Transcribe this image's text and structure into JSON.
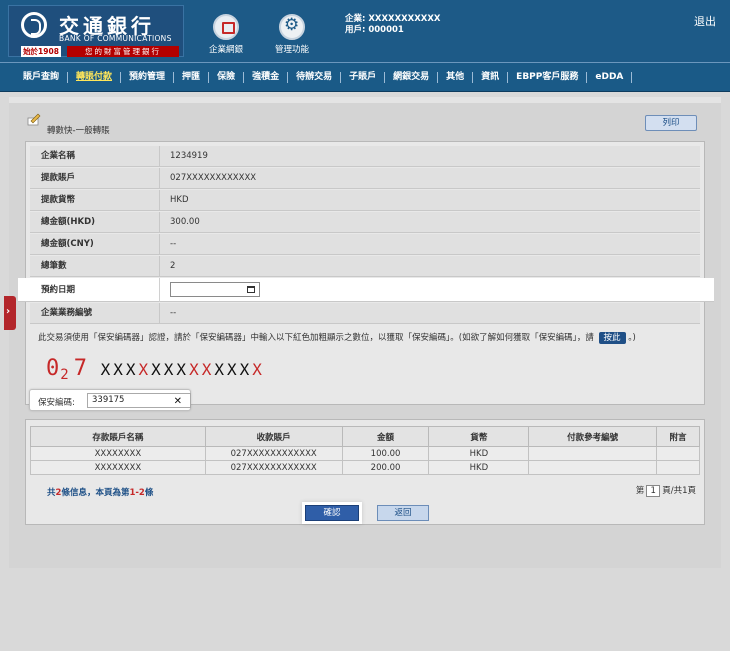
{
  "header": {
    "logo": {
      "cn": "交通銀行",
      "en": "BANK OF COMMUNICATIONS",
      "since": "始於1908",
      "slogan": "您的財富管理銀行"
    },
    "buttons": [
      {
        "label": "企業網銀",
        "icon": "monitor-icon"
      },
      {
        "label": "管理功能",
        "icon": "gear-icon"
      }
    ],
    "company": "企業: XXXXXXXXXXX",
    "user": "用戶: 000001",
    "logout": "退出"
  },
  "menu": {
    "items": [
      "賬戶查詢",
      "轉賬付款",
      "預約管理",
      "押匯",
      "保險",
      "強積金",
      "待辦交易",
      "子賬戶",
      "網銀交易",
      "其他",
      "資訊",
      "EBPP客戶服務",
      "eDDA"
    ],
    "active": "轉賬付款"
  },
  "page": {
    "title": "轉數快-一般轉賬",
    "print": "列印"
  },
  "form": {
    "company_name": {
      "label": "企業名稱",
      "value": "1234919"
    },
    "account": {
      "label": "提款賬戶",
      "value": "027XXXXXXXXXXXX"
    },
    "currency": {
      "label": "提款貨幣",
      "value": "HKD"
    },
    "total_hkd": {
      "label": "總金額(HKD)",
      "value": "300.00"
    },
    "total_cny": {
      "label": "總金額(CNY)",
      "value": "--"
    },
    "count": {
      "label": "總筆數",
      "value": "2"
    },
    "appoint_date": {
      "label": "預約日期",
      "value": ""
    },
    "biz_no": {
      "label": "企業業務編號",
      "value": "--"
    }
  },
  "token": {
    "info": "此交易須使用「保安編碼器」認證，請於「保安編碼器」中輸入以下紅色加粗顯示之數位，以獲取「保安編碼」。(如欲了解如何獲取「保安編碼」，請",
    "hint_btn": "按此",
    "info_end": "。)",
    "code_prefix_big": "0",
    "code_prefix_sub": "2",
    "code_prefix_big2": "7",
    "code_chars": [
      "X",
      "X",
      "X",
      "X",
      "X",
      "X",
      "X",
      "X",
      "X",
      "X",
      "X",
      "X",
      "X"
    ],
    "code_red": [
      false,
      false,
      false,
      true,
      false,
      false,
      false,
      true,
      true,
      false,
      false,
      false,
      true
    ],
    "label": "保安編碼:",
    "value": "339175"
  },
  "table": {
    "headers": [
      "存款賬戶名稱",
      "收款賬戶",
      "金額",
      "貨幣",
      "付款參考編號",
      "附言"
    ],
    "rows": [
      [
        "XXXXXXXX",
        "027XXXXXXXXXXXX",
        "100.00",
        "HKD",
        "",
        ""
      ],
      [
        "XXXXXXXX",
        "027XXXXXXXXXXXX",
        "200.00",
        "HKD",
        "",
        ""
      ]
    ],
    "summary_pre": "共",
    "summary_count": "2",
    "summary_mid": "條信息，本頁為第",
    "summary_range": "1-2",
    "summary_end": "條",
    "pager_pre": "第",
    "pager_page": "1",
    "pager_post": "頁/共1頁"
  },
  "actions": {
    "confirm": "確認",
    "back": "返回"
  }
}
